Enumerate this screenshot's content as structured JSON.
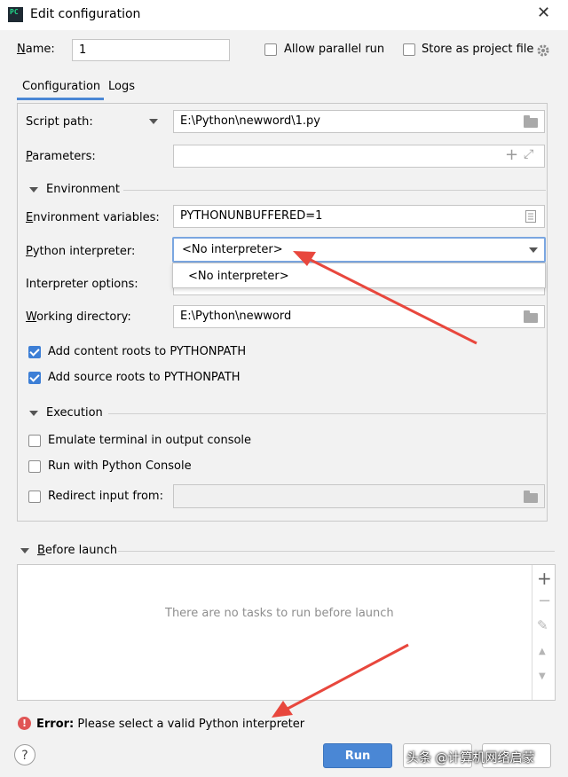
{
  "window": {
    "title": "Edit configuration",
    "app_icon": "PC",
    "close": "✕"
  },
  "top": {
    "name_label": "Name:",
    "name_value": "1",
    "allow_parallel_label": "Allow parallel run",
    "store_project_label": "Store as project file"
  },
  "tabs": [
    {
      "label": "Configuration"
    },
    {
      "label": "Logs"
    }
  ],
  "form": {
    "script_path_label": "Script path:",
    "script_path_value": "E:\\Python\\newword\\1.py",
    "parameters_label": "Parameters:",
    "environment_section": "Environment",
    "env_vars_label": "Environment variables:",
    "env_vars_value": "PYTHONUNBUFFERED=1",
    "interpreter_label": "Python interpreter:",
    "interpreter_value": "<No interpreter>",
    "interpreter_dropdown_item": "<No interpreter>",
    "interpreter_options_label": "Interpreter options:",
    "working_dir_label": "Working directory:",
    "working_dir_value": "E:\\Python\\newword",
    "add_content_roots": "Add content roots to PYTHONPATH",
    "add_source_roots": "Add source roots to PYTHONPATH",
    "execution_section": "Execution",
    "emulate_terminal": "Emulate terminal in output console",
    "run_python_console": "Run with Python Console",
    "redirect_input": "Redirect input from:"
  },
  "before_launch": {
    "title": "Before launch",
    "empty_text": "There are no tasks to run before launch"
  },
  "error": {
    "prefix": "Error:",
    "message": "Please select a valid Python interpreter"
  },
  "buttons": {
    "help": "?",
    "run": "Run"
  },
  "watermark": "头条 @计算机网络启蒙",
  "colors": {
    "accent": "#4a87d5",
    "error": "#e05555",
    "annotation_arrow": "#e8473d"
  }
}
